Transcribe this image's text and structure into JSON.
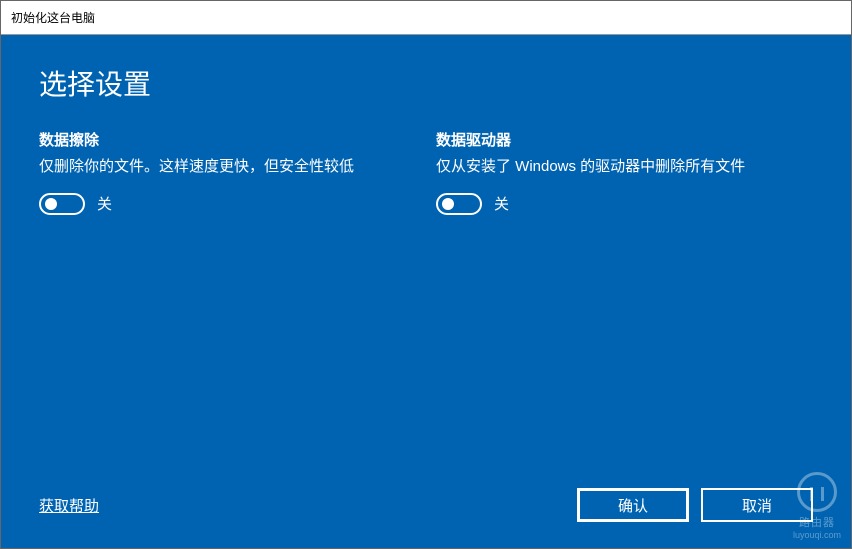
{
  "window": {
    "title": "初始化这台电脑"
  },
  "page": {
    "title": "选择设置"
  },
  "settings": {
    "dataErase": {
      "title": "数据擦除",
      "description": "仅删除你的文件。这样速度更快，但安全性较低",
      "toggleLabel": "关"
    },
    "dataDrives": {
      "title": "数据驱动器",
      "description": "仅从安装了 Windows 的驱动器中删除所有文件",
      "toggleLabel": "关"
    }
  },
  "footer": {
    "helpLink": "获取帮助",
    "confirmButton": "确认",
    "cancelButton": "取消"
  },
  "watermark": {
    "text": "路由器",
    "url": "luyouqi.com"
  }
}
